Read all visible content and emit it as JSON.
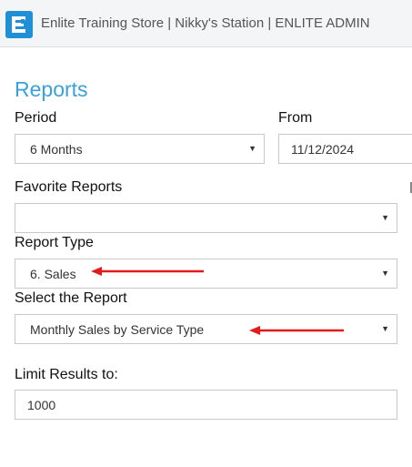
{
  "header": {
    "title": "Enlite Training Store | Nikky's Station | ENLITE ADMIN",
    "logo_icon": "enlite-e-logo",
    "accent": "#1f8fd6"
  },
  "page": {
    "title": "Reports",
    "title_color": "#3aa0dc"
  },
  "form": {
    "period": {
      "label": "Period",
      "value": "6 Months"
    },
    "from": {
      "label": "From",
      "value": "11/12/2024"
    },
    "favorite_reports": {
      "label": "Favorite Reports",
      "value": ""
    },
    "report_type": {
      "label": "Report Type",
      "value": "6. Sales"
    },
    "select_report": {
      "label": "Select the Report",
      "value": "Monthly Sales by Service Type"
    },
    "limit_results": {
      "label": "Limit Results to:",
      "value": "1000"
    }
  },
  "annotations": {
    "arrow_color": "#e31b1b"
  }
}
